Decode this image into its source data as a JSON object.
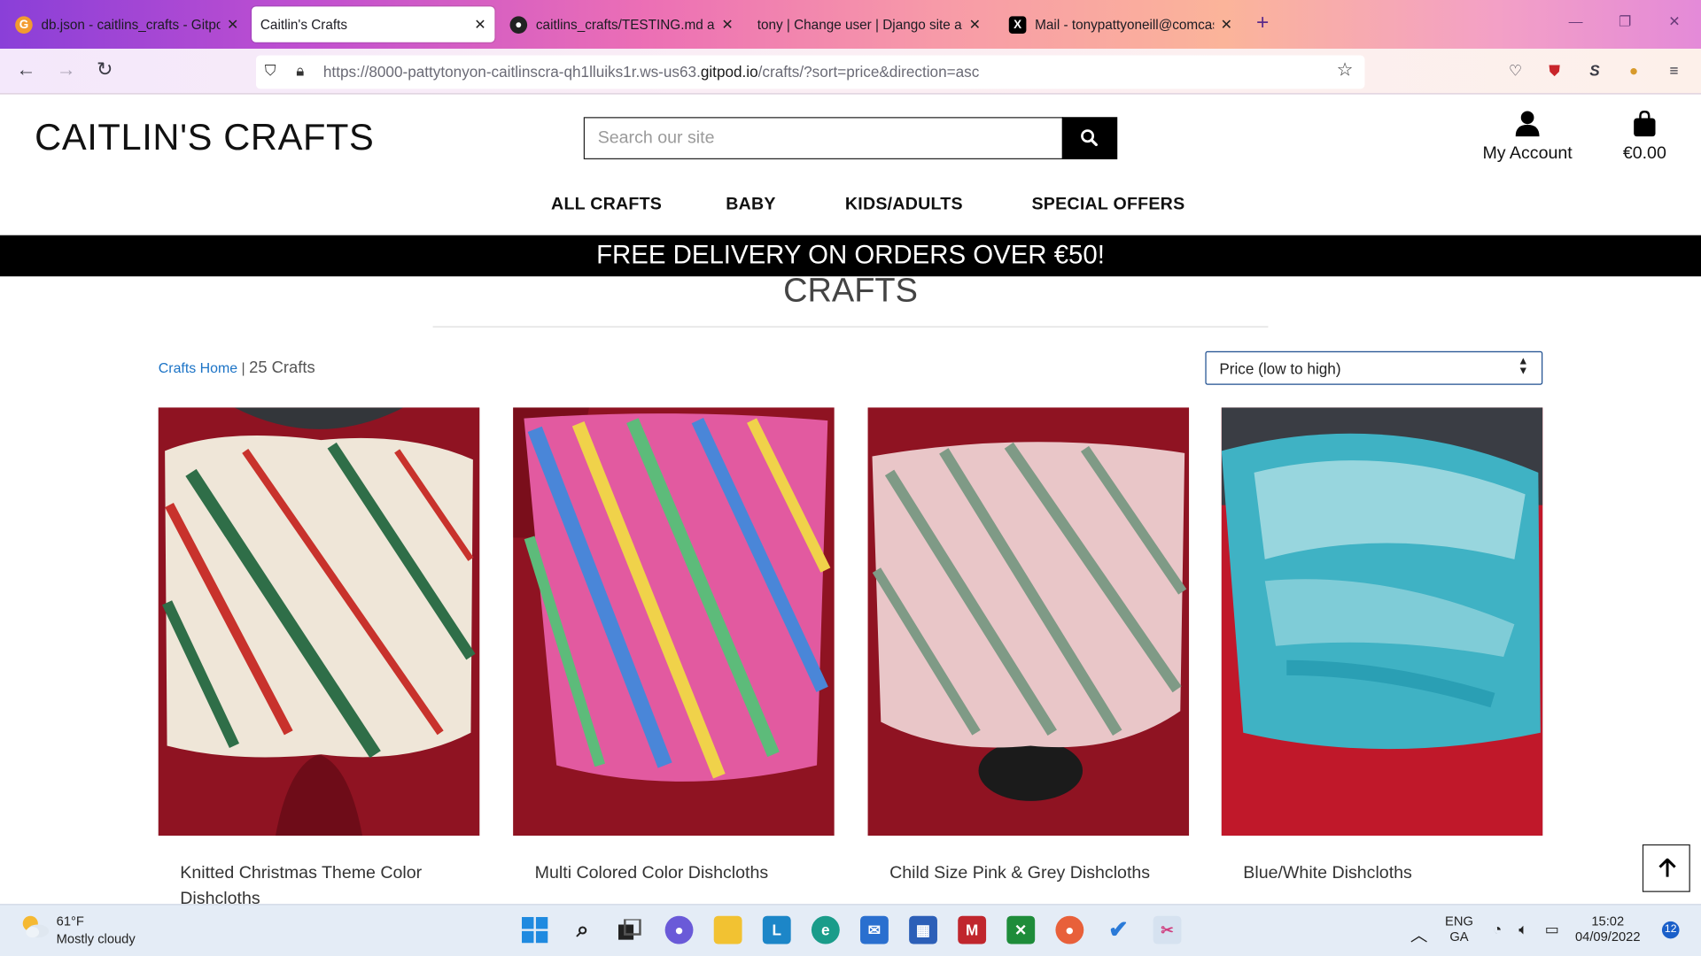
{
  "browser": {
    "tabs": [
      {
        "title": "db.json - caitlins_crafts - Gitpod",
        "icon": "gitpod-icon",
        "active": false
      },
      {
        "title": "Caitlin's Crafts",
        "icon": "",
        "active": true
      },
      {
        "title": "caitlins_crafts/TESTING.md at m",
        "icon": "github-icon",
        "active": false
      },
      {
        "title": "tony | Change user | Django site ad",
        "icon": "",
        "active": false
      },
      {
        "title": "Mail - tonypattyoneill@comcast",
        "icon": "x-mail-icon",
        "active": false
      }
    ],
    "url_prefix": "https://8000-pattytonyon-caitlinscra-qh1lluiks1r.ws-us63.",
    "url_domain": "gitpod.io",
    "url_suffix": "/crafts/?sort=price&direction=asc"
  },
  "site": {
    "logo": "CAITLIN'S CRAFTS",
    "search_placeholder": "Search our site",
    "account_label": "My Account",
    "bag_total": "€0.00",
    "nav": [
      "ALL CRAFTS",
      "BABY",
      "KIDS/ADULTS",
      "SPECIAL OFFERS"
    ],
    "banner": "FREE DELIVERY ON ORDERS OVER €50!"
  },
  "page": {
    "title": "CRAFTS",
    "breadcrumb_link": "Crafts Home",
    "breadcrumb_sep": " | ",
    "count": "25 Crafts",
    "sort_selected": "Price (low to high)"
  },
  "products": [
    {
      "name": "Knitted Christmas Theme Color Dishcloths",
      "colors": [
        "#efe6d8",
        "#c8322c",
        "#2f6e48"
      ]
    },
    {
      "name": "Multi Colored Color Dishcloths",
      "colors": [
        "#e25aa0",
        "#4a86d8",
        "#f0d24a",
        "#5dbb7a"
      ]
    },
    {
      "name": "Child Size Pink & Grey Dishcloths",
      "colors": [
        "#e9c6c8",
        "#7f9a86",
        "#efe0e0"
      ]
    },
    {
      "name": "Blue/White Dishcloths",
      "colors": [
        "#3fb2c4",
        "#bfe6ea",
        "#2a9fb4"
      ]
    }
  ],
  "taskbar": {
    "weather_temp": "61°F",
    "weather_desc": "Mostly cloudy",
    "lang_top": "ENG",
    "lang_bottom": "GA",
    "time": "15:02",
    "date": "04/09/2022",
    "notifications": "12"
  }
}
